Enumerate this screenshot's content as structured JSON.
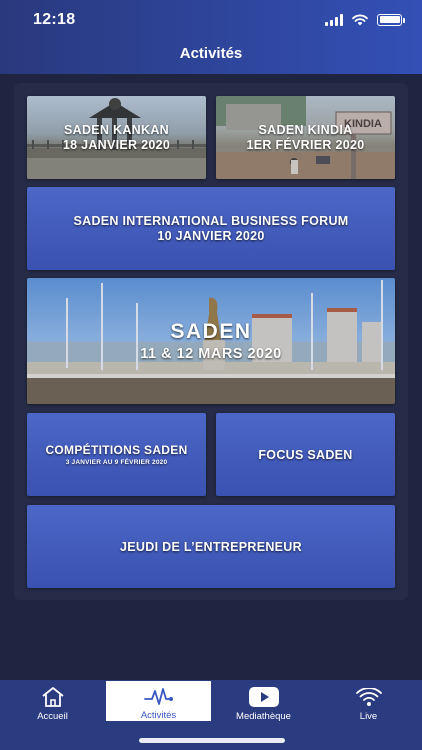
{
  "status_bar": {
    "time": "12:18"
  },
  "header": {
    "title": "Activités"
  },
  "cards": {
    "kankan": {
      "title": "SADEN KANKAN",
      "date": "18 JANVIER 2020"
    },
    "kindia": {
      "title": "SADEN KINDIA",
      "date": "1ER FÉVRIER 2020",
      "sign_text": "KINDIA"
    },
    "forum": {
      "title": "SADEN INTERNATIONAL BUSINESS FORUM",
      "date": "10 JANVIER 2020"
    },
    "saden": {
      "title": "SADEN",
      "date": "11 & 12 MARS 2020"
    },
    "competitions": {
      "title": "COMPÉTITIONS SADEN",
      "sub": "3 JANVIER AU 9 FÉVRIER 2020"
    },
    "focus": {
      "title": "FOCUS SADEN"
    },
    "jeudi": {
      "title": "JEUDI DE L’ENTREPRENEUR"
    }
  },
  "tabs": [
    {
      "label": "Accueil",
      "icon": "home-icon",
      "active": false
    },
    {
      "label": "Activités",
      "icon": "pulse-icon",
      "active": true
    },
    {
      "label": "Mediathèque",
      "icon": "play-icon",
      "active": false
    },
    {
      "label": "Live",
      "icon": "broadcast-icon",
      "active": false
    }
  ],
  "colors": {
    "background": "#1f2540",
    "header_start": "#29397d",
    "header_end": "#3350b6",
    "card": "#4461c2",
    "tabbar": "#2b3b80",
    "active_accent": "#3a56c3"
  }
}
